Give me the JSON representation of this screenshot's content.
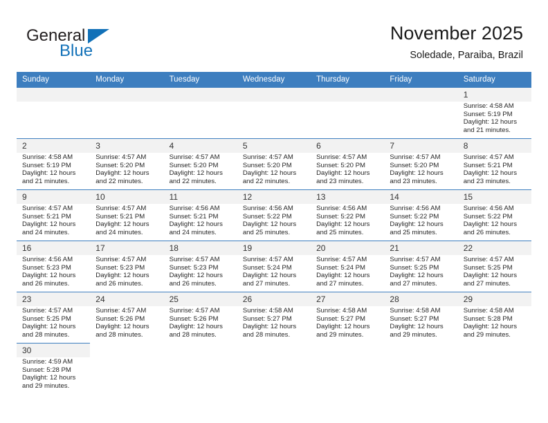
{
  "brand": {
    "name_top": "General",
    "name_bottom": "Blue",
    "triangle_color": "#1271b8"
  },
  "header": {
    "title": "November 2025",
    "subtitle": "Soledade, Paraiba, Brazil"
  },
  "theme": {
    "header_blue": "#3d7ebf",
    "daynum_bg": "#f2f2f2",
    "text": "#262626"
  },
  "labels": {
    "sunrise_prefix": "Sunrise:",
    "sunset_prefix": "Sunset:",
    "daylight_prefix": "Daylight:"
  },
  "weekdays": [
    "Sunday",
    "Monday",
    "Tuesday",
    "Wednesday",
    "Thursday",
    "Friday",
    "Saturday"
  ],
  "weeks": [
    [
      {
        "empty": true
      },
      {
        "empty": true
      },
      {
        "empty": true
      },
      {
        "empty": true
      },
      {
        "empty": true
      },
      {
        "empty": true
      },
      {
        "day": "1",
        "sunrise": "Sunrise: 4:58 AM",
        "sunset": "Sunset: 5:19 PM",
        "daylight_1": "Daylight: 12 hours",
        "daylight_2": "and 21 minutes."
      }
    ],
    [
      {
        "day": "2",
        "sunrise": "Sunrise: 4:58 AM",
        "sunset": "Sunset: 5:19 PM",
        "daylight_1": "Daylight: 12 hours",
        "daylight_2": "and 21 minutes."
      },
      {
        "day": "3",
        "sunrise": "Sunrise: 4:57 AM",
        "sunset": "Sunset: 5:20 PM",
        "daylight_1": "Daylight: 12 hours",
        "daylight_2": "and 22 minutes."
      },
      {
        "day": "4",
        "sunrise": "Sunrise: 4:57 AM",
        "sunset": "Sunset: 5:20 PM",
        "daylight_1": "Daylight: 12 hours",
        "daylight_2": "and 22 minutes."
      },
      {
        "day": "5",
        "sunrise": "Sunrise: 4:57 AM",
        "sunset": "Sunset: 5:20 PM",
        "daylight_1": "Daylight: 12 hours",
        "daylight_2": "and 22 minutes."
      },
      {
        "day": "6",
        "sunrise": "Sunrise: 4:57 AM",
        "sunset": "Sunset: 5:20 PM",
        "daylight_1": "Daylight: 12 hours",
        "daylight_2": "and 23 minutes."
      },
      {
        "day": "7",
        "sunrise": "Sunrise: 4:57 AM",
        "sunset": "Sunset: 5:20 PM",
        "daylight_1": "Daylight: 12 hours",
        "daylight_2": "and 23 minutes."
      },
      {
        "day": "8",
        "sunrise": "Sunrise: 4:57 AM",
        "sunset": "Sunset: 5:21 PM",
        "daylight_1": "Daylight: 12 hours",
        "daylight_2": "and 23 minutes."
      }
    ],
    [
      {
        "day": "9",
        "sunrise": "Sunrise: 4:57 AM",
        "sunset": "Sunset: 5:21 PM",
        "daylight_1": "Daylight: 12 hours",
        "daylight_2": "and 24 minutes."
      },
      {
        "day": "10",
        "sunrise": "Sunrise: 4:57 AM",
        "sunset": "Sunset: 5:21 PM",
        "daylight_1": "Daylight: 12 hours",
        "daylight_2": "and 24 minutes."
      },
      {
        "day": "11",
        "sunrise": "Sunrise: 4:56 AM",
        "sunset": "Sunset: 5:21 PM",
        "daylight_1": "Daylight: 12 hours",
        "daylight_2": "and 24 minutes."
      },
      {
        "day": "12",
        "sunrise": "Sunrise: 4:56 AM",
        "sunset": "Sunset: 5:22 PM",
        "daylight_1": "Daylight: 12 hours",
        "daylight_2": "and 25 minutes."
      },
      {
        "day": "13",
        "sunrise": "Sunrise: 4:56 AM",
        "sunset": "Sunset: 5:22 PM",
        "daylight_1": "Daylight: 12 hours",
        "daylight_2": "and 25 minutes."
      },
      {
        "day": "14",
        "sunrise": "Sunrise: 4:56 AM",
        "sunset": "Sunset: 5:22 PM",
        "daylight_1": "Daylight: 12 hours",
        "daylight_2": "and 25 minutes."
      },
      {
        "day": "15",
        "sunrise": "Sunrise: 4:56 AM",
        "sunset": "Sunset: 5:22 PM",
        "daylight_1": "Daylight: 12 hours",
        "daylight_2": "and 26 minutes."
      }
    ],
    [
      {
        "day": "16",
        "sunrise": "Sunrise: 4:56 AM",
        "sunset": "Sunset: 5:23 PM",
        "daylight_1": "Daylight: 12 hours",
        "daylight_2": "and 26 minutes."
      },
      {
        "day": "17",
        "sunrise": "Sunrise: 4:57 AM",
        "sunset": "Sunset: 5:23 PM",
        "daylight_1": "Daylight: 12 hours",
        "daylight_2": "and 26 minutes."
      },
      {
        "day": "18",
        "sunrise": "Sunrise: 4:57 AM",
        "sunset": "Sunset: 5:23 PM",
        "daylight_1": "Daylight: 12 hours",
        "daylight_2": "and 26 minutes."
      },
      {
        "day": "19",
        "sunrise": "Sunrise: 4:57 AM",
        "sunset": "Sunset: 5:24 PM",
        "daylight_1": "Daylight: 12 hours",
        "daylight_2": "and 27 minutes."
      },
      {
        "day": "20",
        "sunrise": "Sunrise: 4:57 AM",
        "sunset": "Sunset: 5:24 PM",
        "daylight_1": "Daylight: 12 hours",
        "daylight_2": "and 27 minutes."
      },
      {
        "day": "21",
        "sunrise": "Sunrise: 4:57 AM",
        "sunset": "Sunset: 5:25 PM",
        "daylight_1": "Daylight: 12 hours",
        "daylight_2": "and 27 minutes."
      },
      {
        "day": "22",
        "sunrise": "Sunrise: 4:57 AM",
        "sunset": "Sunset: 5:25 PM",
        "daylight_1": "Daylight: 12 hours",
        "daylight_2": "and 27 minutes."
      }
    ],
    [
      {
        "day": "23",
        "sunrise": "Sunrise: 4:57 AM",
        "sunset": "Sunset: 5:25 PM",
        "daylight_1": "Daylight: 12 hours",
        "daylight_2": "and 28 minutes."
      },
      {
        "day": "24",
        "sunrise": "Sunrise: 4:57 AM",
        "sunset": "Sunset: 5:26 PM",
        "daylight_1": "Daylight: 12 hours",
        "daylight_2": "and 28 minutes."
      },
      {
        "day": "25",
        "sunrise": "Sunrise: 4:57 AM",
        "sunset": "Sunset: 5:26 PM",
        "daylight_1": "Daylight: 12 hours",
        "daylight_2": "and 28 minutes."
      },
      {
        "day": "26",
        "sunrise": "Sunrise: 4:58 AM",
        "sunset": "Sunset: 5:27 PM",
        "daylight_1": "Daylight: 12 hours",
        "daylight_2": "and 28 minutes."
      },
      {
        "day": "27",
        "sunrise": "Sunrise: 4:58 AM",
        "sunset": "Sunset: 5:27 PM",
        "daylight_1": "Daylight: 12 hours",
        "daylight_2": "and 29 minutes."
      },
      {
        "day": "28",
        "sunrise": "Sunrise: 4:58 AM",
        "sunset": "Sunset: 5:27 PM",
        "daylight_1": "Daylight: 12 hours",
        "daylight_2": "and 29 minutes."
      },
      {
        "day": "29",
        "sunrise": "Sunrise: 4:58 AM",
        "sunset": "Sunset: 5:28 PM",
        "daylight_1": "Daylight: 12 hours",
        "daylight_2": "and 29 minutes."
      }
    ],
    [
      {
        "day": "30",
        "sunrise": "Sunrise: 4:59 AM",
        "sunset": "Sunset: 5:28 PM",
        "daylight_1": "Daylight: 12 hours",
        "daylight_2": "and 29 minutes."
      },
      {
        "blank": true
      },
      {
        "blank": true
      },
      {
        "blank": true
      },
      {
        "blank": true
      },
      {
        "blank": true
      },
      {
        "blank": true
      }
    ]
  ]
}
